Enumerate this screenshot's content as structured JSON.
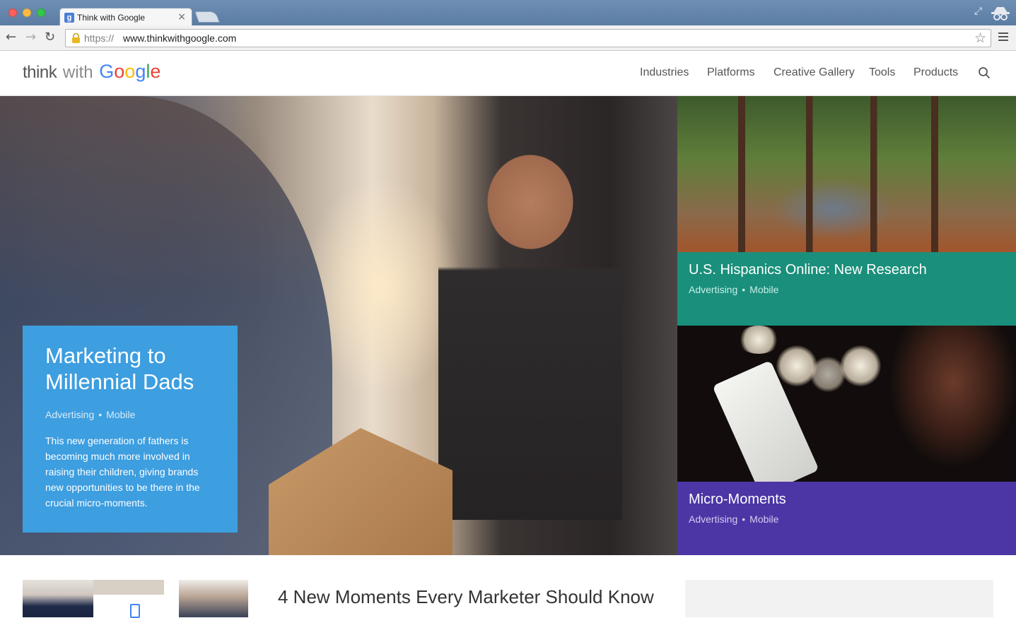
{
  "browser": {
    "tab_title": "Think with Google",
    "tab_close": "×",
    "favicon_letter": "g",
    "url_scheme": "https://",
    "url_host": "www.thinkwithgoogle.com",
    "icons": [
      "back-arrow-icon",
      "forward-arrow-icon",
      "reload-icon",
      "lock-icon",
      "star-icon",
      "menu-icon",
      "incognito-icon",
      "fullscreen-icon"
    ]
  },
  "header": {
    "logo": {
      "think": "think",
      "with": "with",
      "google": [
        "G",
        "o",
        "o",
        "g",
        "l",
        "e"
      ]
    },
    "nav": [
      "Industries",
      "Platforms",
      "Creative Gallery",
      "Tools",
      "Products"
    ]
  },
  "hero": {
    "title": "Marketing to Millennial Dads",
    "tags": [
      "Advertising",
      "Mobile"
    ],
    "separator": "•",
    "description": "This new generation of fathers is becoming much more involved in raising their children, giving brands new opportunities to be there in the crucial micro-moments.",
    "card_color": "#3d9ee0"
  },
  "tiles": [
    {
      "title": "U.S. Hispanics Online: New Research",
      "tags": [
        "Advertising",
        "Mobile"
      ],
      "color": "#1a8f7b"
    },
    {
      "title": "Micro-Moments",
      "tags": [
        "Advertising",
        "Mobile"
      ],
      "color": "#4c35a5"
    }
  ],
  "lower": {
    "article_title": "4 New Moments Every Marketer Should Know"
  }
}
